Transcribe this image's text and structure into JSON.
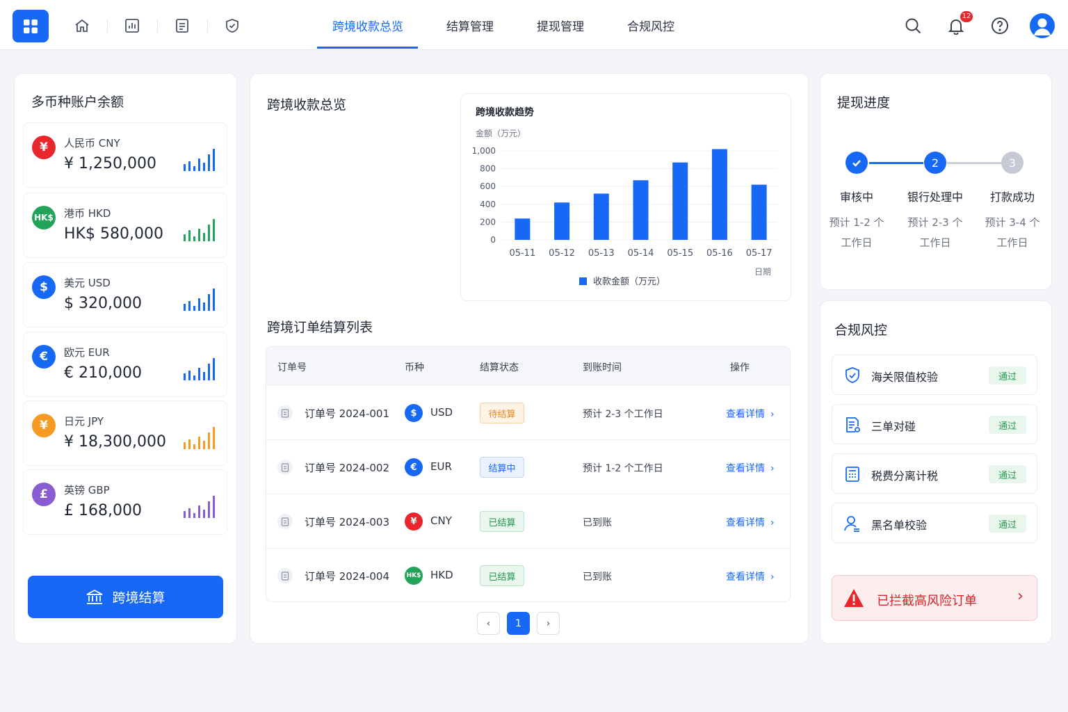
{
  "nav": {
    "tabs": [
      "跨境收款总览",
      "结算管理",
      "提现管理",
      "合规风控"
    ],
    "notification_count": "12",
    "accent_color": "#1769f5"
  },
  "accounts": {
    "title": "多币种账户余额",
    "items": [
      {
        "symbol": "¥",
        "name": "人民币 CNY",
        "amount": "¥ 1,250,000",
        "color": "#e8262b"
      },
      {
        "symbol": "HK$",
        "name": "港币 HKD",
        "amount": "HK$ 580,000",
        "color": "#22a35a"
      },
      {
        "symbol": "$",
        "name": "美元 USD",
        "amount": "$ 320,000",
        "color": "#1769f5"
      },
      {
        "symbol": "€",
        "name": "欧元 EUR",
        "amount": "€ 210,000",
        "color": "#1769f5"
      },
      {
        "symbol": "¥",
        "name": "日元 JPY",
        "amount": "¥ 18,300,000",
        "color": "#f59a23"
      },
      {
        "symbol": "£",
        "name": "英镑 GBP",
        "amount": "£ 168,000",
        "color": "#8a5cd1"
      }
    ],
    "settle_button": "跨境结算"
  },
  "overview": {
    "title": "跨境收款总览",
    "table_title": "跨境订单结算列表"
  },
  "chart_data": {
    "type": "bar",
    "title": "跨境收款趋势",
    "ylabel": "金额（万元）",
    "xlabel": "日期",
    "categories": [
      "05-11",
      "05-12",
      "05-13",
      "05-14",
      "05-15",
      "05-16",
      "05-17"
    ],
    "series": [
      {
        "name": "收款金额（万元）",
        "values": [
          240,
          420,
          520,
          670,
          870,
          1020,
          620
        ]
      }
    ],
    "ylim": [
      0,
      1000
    ],
    "yticks": [
      "1,000",
      "800",
      "600",
      "400",
      "200",
      "0"
    ],
    "grid": true,
    "legend": "bottom",
    "bar_color": "#1769f5"
  },
  "table": {
    "headers": [
      "订单号",
      "币种",
      "结算状态",
      "到账时间",
      "操作"
    ],
    "rows": [
      {
        "order": "订单号  2024-001",
        "cur_symbol": "$",
        "currency": "USD",
        "cur_color": "#1769f5",
        "status": "待结算",
        "status_type": "orange",
        "arrival": "预计 2-3 个工作日",
        "action": "查看详情"
      },
      {
        "order": "订单号  2024-002",
        "cur_symbol": "€",
        "currency": "EUR",
        "cur_color": "#1769f5",
        "status": "结算中",
        "status_type": "blue",
        "arrival": "预计 1-2 个工作日",
        "action": "查看详情"
      },
      {
        "order": "订单号  2024-003",
        "cur_symbol": "¥",
        "currency": "CNY",
        "cur_color": "#e8262b",
        "status": "已结算",
        "status_type": "green",
        "arrival": "已到账",
        "action": "查看详情"
      },
      {
        "order": "订单号  2024-004",
        "cur_symbol": "HK$",
        "currency": "HKD",
        "cur_color": "#22a35a",
        "status": "已结算",
        "status_type": "green",
        "arrival": "已到账",
        "action": "查看详情"
      }
    ],
    "page": "1"
  },
  "withdraw": {
    "title": "提现进度",
    "steps": [
      {
        "num": "",
        "label": "审核中",
        "sub1": "预计 1-2 个",
        "sub2": "工作日"
      },
      {
        "num": "2",
        "label": "银行处理中",
        "sub1": "预计 2-3 个",
        "sub2": "工作日"
      },
      {
        "num": "3",
        "label": "打款成功",
        "sub1": "预计 3-4 个",
        "sub2": "工作日"
      }
    ]
  },
  "compliance": {
    "title": "合规风控",
    "items": [
      {
        "name": "海关限值校验",
        "status": "通过",
        "icon": "shield-check-icon"
      },
      {
        "name": "三单对碰",
        "status": "通过",
        "icon": "document-check-icon"
      },
      {
        "name": "税费分离计税",
        "status": "通过",
        "icon": "calculator-icon"
      },
      {
        "name": "黑名单校验",
        "status": "通过",
        "icon": "user-icon"
      }
    ],
    "alert": "已拦截高风险订单"
  }
}
